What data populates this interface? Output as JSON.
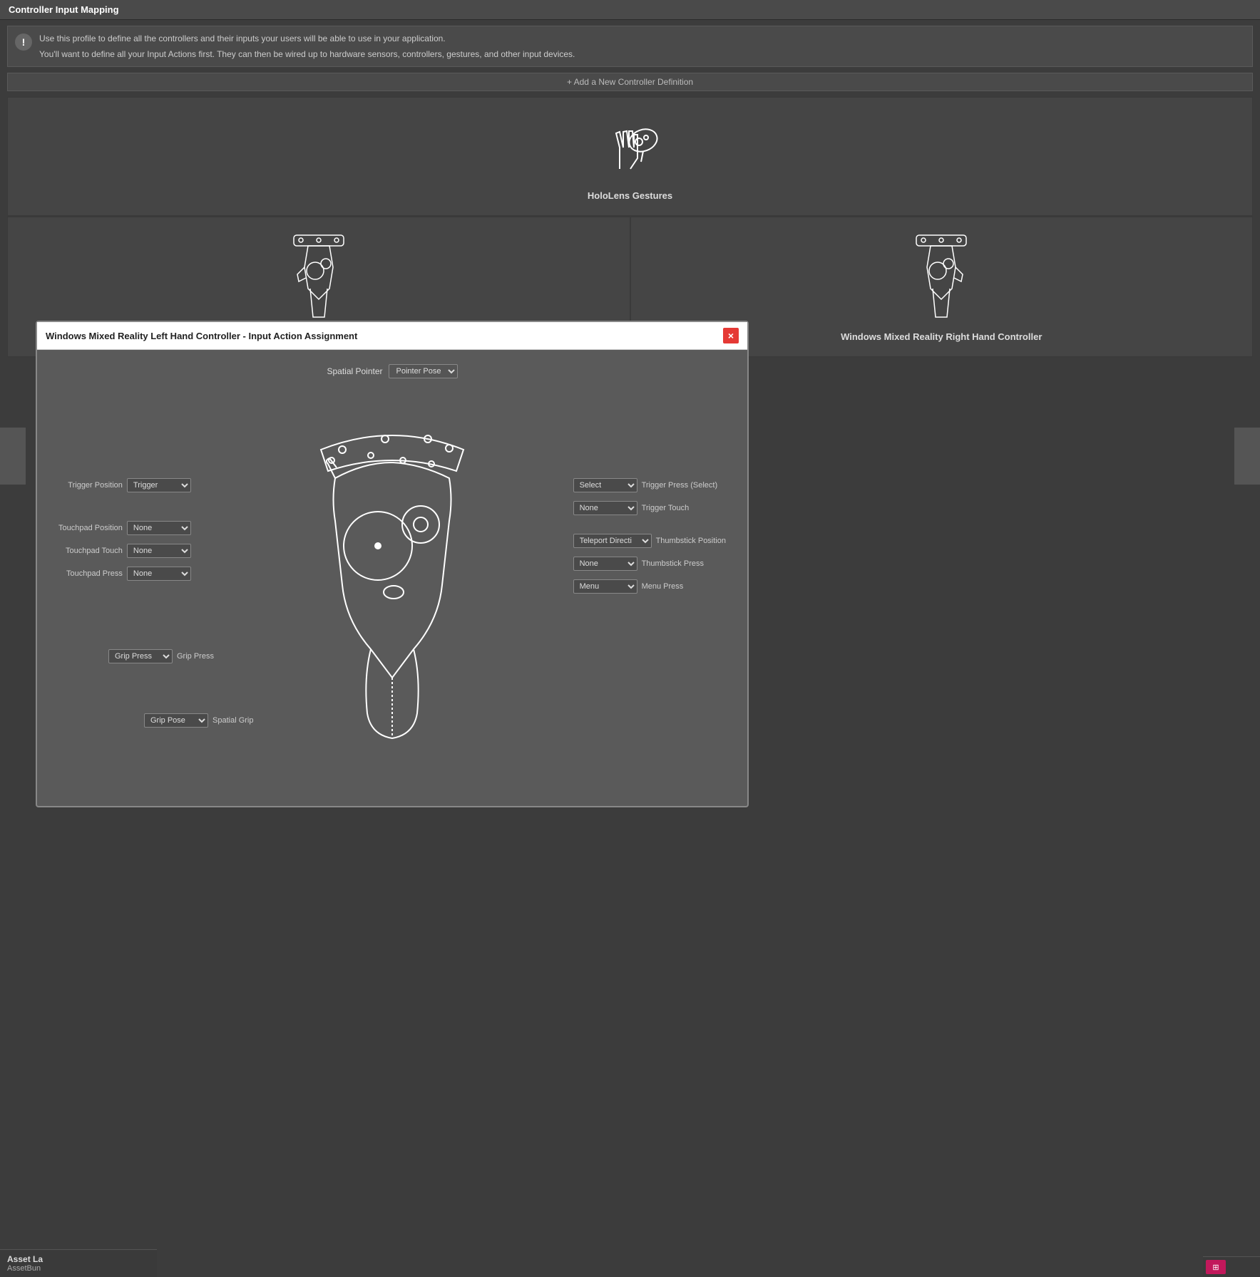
{
  "header": {
    "title": "Controller Input Mapping"
  },
  "info": {
    "line1": "Use this profile to define all the controllers and their inputs your users will be able to use in your application.",
    "line2": "You'll want to define all your Input Actions first. They can then be wired up to hardware sensors, controllers, gestures, and other input devices.",
    "icon": "!"
  },
  "add_button": {
    "label": "+ Add a New Controller Definition"
  },
  "hololens": {
    "label": "HoloLens Gestures"
  },
  "wmr_left": {
    "label": "Windows Mixed Reality Left Hand Controller"
  },
  "wmr_right": {
    "label": "Windows Mixed Reality Right Hand Controller"
  },
  "modal": {
    "title": "Windows Mixed Reality Left Hand Controller - Input Action Assignment",
    "close": "×"
  },
  "spatial_pointer": {
    "label": "Spatial Pointer",
    "dropdown": "Pointer Pose"
  },
  "left_inputs": {
    "trigger_position": {
      "label": "Trigger Position",
      "value": "Trigger"
    },
    "touchpad_position": {
      "label": "Touchpad Position",
      "value": "None"
    },
    "touchpad_touch": {
      "label": "Touchpad Touch",
      "value": "None"
    },
    "touchpad_press": {
      "label": "Touchpad Press",
      "value": "None"
    }
  },
  "right_inputs": {
    "trigger_press_select": {
      "dropdown": "Select",
      "label": "Trigger Press (Select)"
    },
    "trigger_touch": {
      "dropdown": "None",
      "label": "Trigger Touch"
    },
    "thumbstick_position": {
      "dropdown": "Teleport Directi",
      "label": "Thumbstick Position"
    },
    "thumbstick_press": {
      "dropdown": "None",
      "label": "Thumbstick Press"
    },
    "menu_press": {
      "dropdown": "Menu",
      "label": "Menu Press"
    }
  },
  "bottom_inputs": {
    "grip_press": {
      "dropdown": "Grip Press",
      "label": "Grip Press"
    },
    "grip_pose": {
      "dropdown": "Grip Pose",
      "label": "Spatial Grip"
    }
  },
  "asset_panel": {
    "title": "Asset La",
    "subtitle": "AssetBun"
  },
  "icons": {
    "info": "!",
    "close": "×",
    "arrow": "▼"
  }
}
